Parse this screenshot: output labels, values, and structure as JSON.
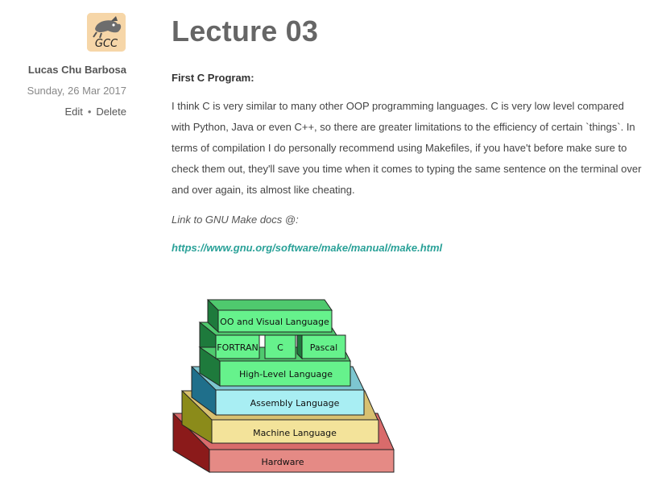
{
  "sidebar": {
    "avatar_text": "GCC",
    "author": "Lucas Chu Barbosa",
    "date": "Sunday, 26 Mar 2017",
    "edit_label": "Edit",
    "separator": "•",
    "delete_label": "Delete"
  },
  "post": {
    "title": "Lecture 03",
    "subheading": "First C Program:",
    "body": "I think C is very similar to many other OOP programming languages. C is very low level compared with Python, Java or even C++, so there are greater limitations to the efficiency of certain `things`. In terms of compilation I do personally recommend using Makefiles, if you have't before make sure to check them out, they'll save you time when it comes to typing the same sentence on the terminal over and over again, its almost like cheating.",
    "link_intro": "Link to GNU Make docs @:",
    "link_text": "https://www.gnu.org/software/make/manual/make.html"
  },
  "diagram": {
    "layers": {
      "oo": "OO and Visual Language",
      "fortran": "FORTRAN",
      "c": "C",
      "pascal": "Pascal",
      "high_level": "High-Level Language",
      "assembly": "Assembly Language",
      "machine": "Machine Language",
      "hardware": "Hardware"
    },
    "colors": {
      "hardware": "#e58a85",
      "machine": "#f3e39a",
      "assembly": "#a8eef3",
      "green": "#66f28c",
      "green_dark": "#1e7a3c",
      "link": "#2aa198"
    }
  }
}
